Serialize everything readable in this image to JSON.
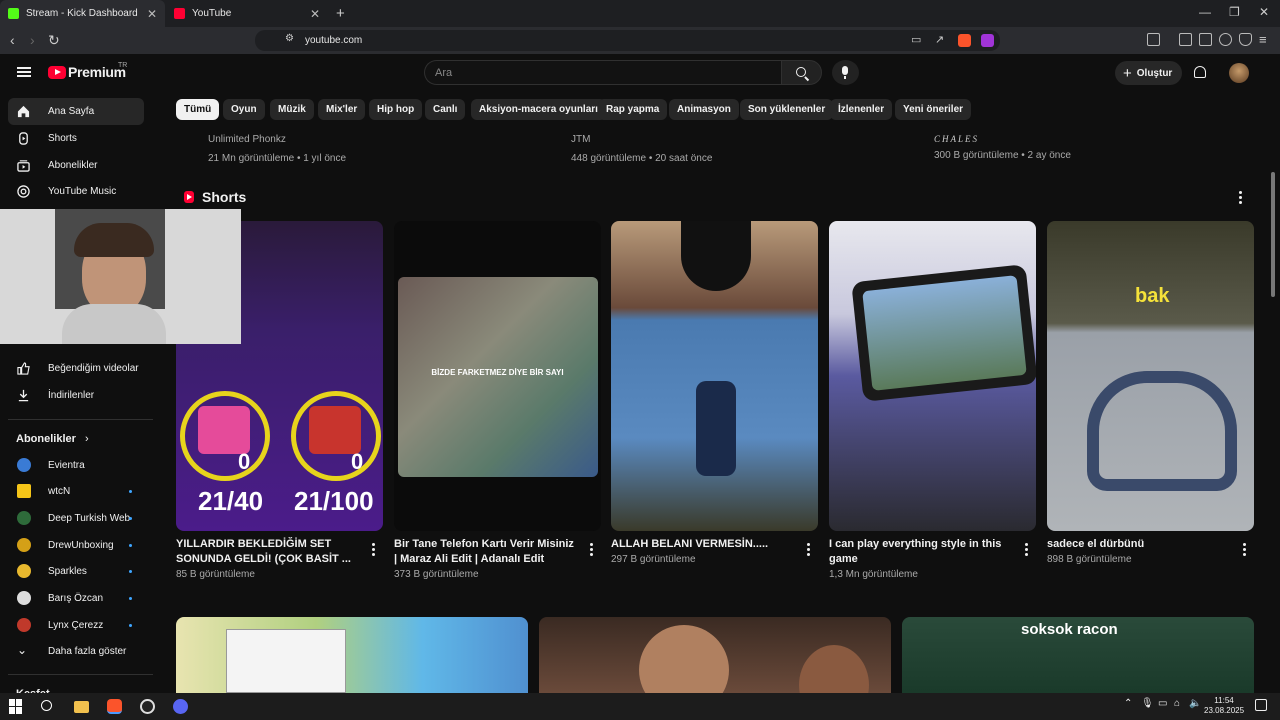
{
  "browser": {
    "tabs": [
      {
        "title": "Stream - Kick Dashboard",
        "active": true,
        "favicon_color": "#53fc18"
      },
      {
        "title": "YouTube",
        "active": false,
        "favicon_color": "#ff0033"
      }
    ],
    "new_tab_label": "+",
    "url": "youtube.com"
  },
  "header": {
    "brand": "Premium",
    "brand_region": "TR",
    "search_placeholder": "Ara",
    "create_label": "Oluştur"
  },
  "sidebar": {
    "main": [
      {
        "label": "Ana Sayfa",
        "icon": "home-icon",
        "active": true
      },
      {
        "label": "Shorts",
        "icon": "shorts-icon"
      },
      {
        "label": "Abonelikler",
        "icon": "subscriptions-icon"
      },
      {
        "label": "YouTube Music",
        "icon": "music-icon"
      }
    ],
    "you": [
      {
        "label": "Beğendiğim videolar",
        "icon": "thumbs-up-icon"
      },
      {
        "label": "İndirilenler",
        "icon": "download-icon"
      }
    ],
    "subs_title": "Abonelikler",
    "subscriptions": [
      {
        "name": "Evientra",
        "color": "#3a7bd5",
        "dot": false
      },
      {
        "name": "wtcN",
        "color": "#f5c518",
        "dot": true
      },
      {
        "name": "Deep Turkish Web",
        "color": "#2e6b3a",
        "dot": true
      },
      {
        "name": "DrewUnboxing",
        "color": "#d4a017",
        "dot": true
      },
      {
        "name": "Sparkles",
        "color": "#e8b82e",
        "dot": true
      },
      {
        "name": "Barış Özcan",
        "color": "#dddddd",
        "dot": true
      },
      {
        "name": "Lynx Çerezz",
        "color": "#c0392b",
        "dot": true
      }
    ],
    "show_more": "Daha fazla göster",
    "explore_partial": "Keşfet"
  },
  "chips": [
    "Tümü",
    "Oyun",
    "Müzik",
    "Mix'ler",
    "Hip hop",
    "Canlı",
    "Aksiyon-macera oyunları",
    "Rap yapma",
    "Animasyon",
    "Son yüklenenler",
    "İzlenenler",
    "Yeni öneriler"
  ],
  "previous_videos": [
    {
      "channel": "Unlimited Phonkz",
      "meta": "21 Mn görüntüleme • 1 yıl önce"
    },
    {
      "channel": "JTM",
      "meta": "448 görüntüleme • 20 saat önce"
    },
    {
      "channel": "CHALES",
      "meta": "300 B görüntüleme • 2 ay önce"
    }
  ],
  "shorts": {
    "section_title": "Shorts",
    "items": [
      {
        "title": "YILLARDIR BEKLEDİĞİM SET SONUNDA GELDİ! (ÇOK BASİT ...",
        "views": "85 B görüntüleme",
        "overlay_a": "21/40",
        "overlay_b": "21/100",
        "count": "0"
      },
      {
        "title": "Bir Tane Telefon Kartı Verir Misiniz | Maraz Ali Edit | Adanalı Edit",
        "views": "373 B görüntüleme",
        "caption": "BİZDE FARKETMEZ DİYE BİR SAYI"
      },
      {
        "title": "ALLAH BELANI VERMESİN.....",
        "views": "297 B görüntüleme"
      },
      {
        "title": "I can play everything style in this game",
        "views": "1,3 Mn görüntüleme"
      },
      {
        "title": "sadece el dürbünü",
        "views": "898 B görüntüleme",
        "caption": "bak"
      }
    ]
  },
  "next_row": {
    "third_caption": "soksok racon"
  },
  "taskbar": {
    "time": "11:54",
    "date": "23.08.2025"
  }
}
